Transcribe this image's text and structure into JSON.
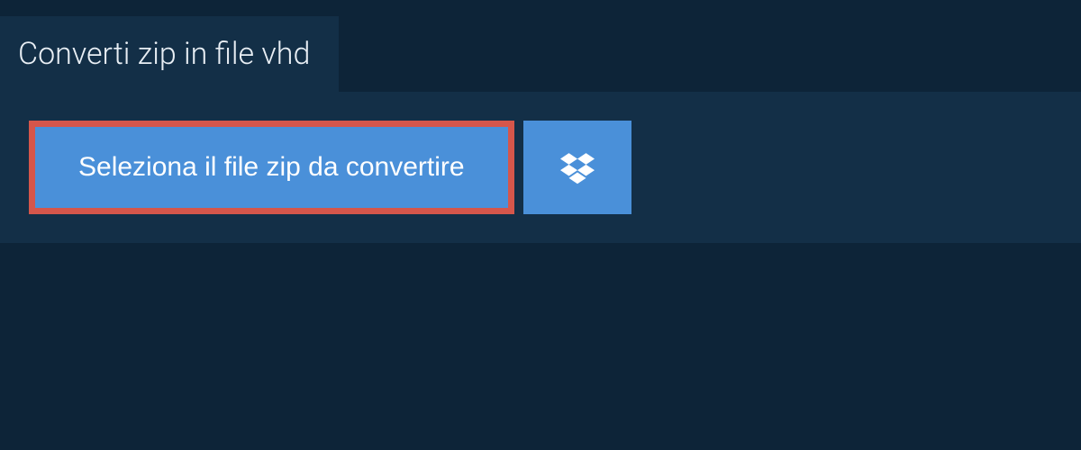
{
  "header": {
    "title": "Converti zip in file vhd"
  },
  "actions": {
    "select_file_label": "Seleziona il file zip da convertire"
  },
  "colors": {
    "background": "#0d2438",
    "panel": "#132f47",
    "button": "#4a90d9",
    "highlight_border": "#d5564b",
    "text_light": "#e8eef4"
  }
}
